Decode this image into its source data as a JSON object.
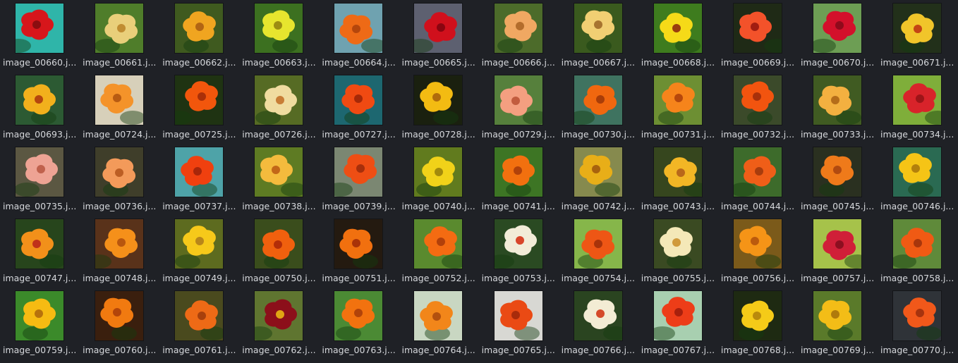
{
  "files": [
    {
      "name": "image_00660.j...",
      "bg": "#2fb5a9",
      "petal": "#d7161b",
      "center": "#8a0d10",
      "icon": "flower-photo"
    },
    {
      "name": "image_00661.j...",
      "bg": "#4f7d2a",
      "petal": "#e9cf7a",
      "center": "#c08d32",
      "icon": "flower-photo"
    },
    {
      "name": "image_00662.j...",
      "bg": "#3f5a1f",
      "petal": "#f0a520",
      "center": "#b26513",
      "icon": "flower-photo"
    },
    {
      "name": "image_00663.j...",
      "bg": "#3c7020",
      "petal": "#e7e52e",
      "center": "#9d8d12",
      "icon": "flower-photo"
    },
    {
      "name": "image_00664.j...",
      "bg": "#6fa2b0",
      "petal": "#ee6a16",
      "center": "#b5460c",
      "icon": "flower-photo"
    },
    {
      "name": "image_00665.j...",
      "bg": "#5d6070",
      "petal": "#d0101c",
      "center": "#8a0510",
      "icon": "flower-photo"
    },
    {
      "name": "image_00666.j...",
      "bg": "#4c6b2a",
      "petal": "#f0a862",
      "center": "#b36d2c",
      "icon": "flower-photo"
    },
    {
      "name": "image_00667.j...",
      "bg": "#3a5a1e",
      "petal": "#f1cf73",
      "center": "#a77430",
      "icon": "flower-photo"
    },
    {
      "name": "image_00668.j...",
      "bg": "#3e7c1e",
      "petal": "#f5da18",
      "center": "#9a3d0e",
      "icon": "flower-photo"
    },
    {
      "name": "image_00669.j...",
      "bg": "#1f2a16",
      "petal": "#f3522a",
      "center": "#a11d11",
      "icon": "flower-photo"
    },
    {
      "name": "image_00670.j...",
      "bg": "#6d9e54",
      "petal": "#d3102b",
      "center": "#8f0a1b",
      "icon": "flower-photo"
    },
    {
      "name": "image_00671.j...",
      "bg": "#22301a",
      "petal": "#f1c52a",
      "center": "#c44414",
      "icon": "flower-photo"
    },
    {
      "name": "image_00693.j...",
      "bg": "#2c5a33",
      "petal": "#f2b01c",
      "center": "#b5460e",
      "icon": "flower-photo"
    },
    {
      "name": "image_00724.j...",
      "bg": "#d7d0ba",
      "petal": "#f4932a",
      "center": "#b85b12",
      "icon": "flower-photo"
    },
    {
      "name": "image_00725.j...",
      "bg": "#1f3312",
      "petal": "#f2560c",
      "center": "#a92f08",
      "icon": "flower-photo"
    },
    {
      "name": "image_00726.j...",
      "bg": "#566b24",
      "petal": "#f0dca0",
      "center": "#c87d36",
      "icon": "flower-photo"
    },
    {
      "name": "image_00727.j...",
      "bg": "#1d6770",
      "petal": "#f04a12",
      "center": "#a52908",
      "icon": "flower-photo"
    },
    {
      "name": "image_00728.j...",
      "bg": "#1a200f",
      "petal": "#f3bb12",
      "center": "#b06b0b",
      "icon": "flower-photo"
    },
    {
      "name": "image_00729.j...",
      "bg": "#56803c",
      "petal": "#f49f80",
      "center": "#c25c3e",
      "icon": "flower-photo"
    },
    {
      "name": "image_00730.j...",
      "bg": "#3f7360",
      "petal": "#f0670f",
      "center": "#a93d08",
      "icon": "flower-photo"
    },
    {
      "name": "image_00731.j...",
      "bg": "#6d8f33",
      "petal": "#f6841b",
      "center": "#b6470c",
      "icon": "flower-photo"
    },
    {
      "name": "image_00732.j...",
      "bg": "#3b4a2a",
      "petal": "#f2540f",
      "center": "#a8300a",
      "icon": "flower-photo"
    },
    {
      "name": "image_00733.j...",
      "bg": "#405b22",
      "petal": "#f3b040",
      "center": "#b56d1a",
      "icon": "flower-photo"
    },
    {
      "name": "image_00734.j...",
      "bg": "#7fae3a",
      "petal": "#d8232a",
      "center": "#9d1418",
      "icon": "flower-photo"
    },
    {
      "name": "image_00735.j...",
      "bg": "#5b5742",
      "petal": "#eea394",
      "center": "#c0614d",
      "icon": "flower-photo"
    },
    {
      "name": "image_00736.j...",
      "bg": "#3f3e2a",
      "petal": "#f39a5a",
      "center": "#bc5e24",
      "icon": "flower-photo"
    },
    {
      "name": "image_00737.j...",
      "bg": "#4ea3a8",
      "petal": "#f0400f",
      "center": "#a8260a",
      "icon": "flower-photo"
    },
    {
      "name": "image_00738.j...",
      "bg": "#5e7b23",
      "petal": "#f4bb3d",
      "center": "#c26718",
      "icon": "flower-photo"
    },
    {
      "name": "image_00739.j...",
      "bg": "#7b8772",
      "petal": "#ee4e14",
      "center": "#a72f0b",
      "icon": "flower-photo"
    },
    {
      "name": "image_00740.j...",
      "bg": "#617b1e",
      "petal": "#f1d219",
      "center": "#a38a0c",
      "icon": "flower-photo"
    },
    {
      "name": "image_00741.j...",
      "bg": "#3d7524",
      "petal": "#f2700f",
      "center": "#b1410a",
      "icon": "flower-photo"
    },
    {
      "name": "image_00742.j...",
      "bg": "#868a4e",
      "petal": "#e8ae18",
      "center": "#a8620e",
      "icon": "flower-photo"
    },
    {
      "name": "image_00743.j...",
      "bg": "#36461e",
      "petal": "#f2b625",
      "center": "#b9681a",
      "icon": "flower-photo"
    },
    {
      "name": "image_00744.j...",
      "bg": "#3d6b2b",
      "petal": "#ef5e18",
      "center": "#a83c0d",
      "icon": "flower-photo"
    },
    {
      "name": "image_00745.j...",
      "bg": "#2a3020",
      "petal": "#ef7a1a",
      "center": "#b14a10",
      "icon": "flower-photo"
    },
    {
      "name": "image_00746.j...",
      "bg": "#2a6a52",
      "petal": "#f5c416",
      "center": "#b3800c",
      "icon": "flower-photo"
    },
    {
      "name": "image_00747.j...",
      "bg": "#27451c",
      "petal": "#f2901a",
      "center": "#c0311a",
      "icon": "flower-photo"
    },
    {
      "name": "image_00748.j...",
      "bg": "#59321a",
      "petal": "#f5901a",
      "center": "#b8560e",
      "icon": "flower-photo"
    },
    {
      "name": "image_00749.j...",
      "bg": "#5d6b1f",
      "petal": "#f6c91a",
      "center": "#b8861a",
      "icon": "flower-photo"
    },
    {
      "name": "image_00750.j...",
      "bg": "#3a4d1c",
      "petal": "#f0600e",
      "center": "#b32d08",
      "icon": "flower-photo"
    },
    {
      "name": "image_00751.j...",
      "bg": "#241a10",
      "petal": "#f1700f",
      "center": "#a93308",
      "icon": "flower-photo"
    },
    {
      "name": "image_00752.j...",
      "bg": "#5a8a2e",
      "petal": "#f46b12",
      "center": "#b2400a",
      "icon": "flower-photo"
    },
    {
      "name": "image_00753.j...",
      "bg": "#2a4a22",
      "petal": "#f2ecd8",
      "center": "#d8452a",
      "icon": "flower-photo"
    },
    {
      "name": "image_00754.j...",
      "bg": "#86b64a",
      "petal": "#ee5615",
      "center": "#a8330a",
      "icon": "flower-photo"
    },
    {
      "name": "image_00755.j...",
      "bg": "#3a4a22",
      "petal": "#f4e8b8",
      "center": "#d09a3c",
      "icon": "flower-photo"
    },
    {
      "name": "image_00756.j...",
      "bg": "#7b5a1a",
      "petal": "#f59417",
      "center": "#bb5a0d",
      "icon": "flower-photo"
    },
    {
      "name": "image_00757.j...",
      "bg": "#a6c24a",
      "petal": "#d01f38",
      "center": "#8c0f20",
      "icon": "flower-photo"
    },
    {
      "name": "image_00758.j...",
      "bg": "#5f8a3a",
      "petal": "#f05a14",
      "center": "#a8360c",
      "icon": "flower-photo"
    },
    {
      "name": "image_00759.j...",
      "bg": "#3b8a2a",
      "petal": "#f6bb12",
      "center": "#b7720c",
      "icon": "flower-photo"
    },
    {
      "name": "image_00760.j...",
      "bg": "#3a1f0e",
      "petal": "#f17a10",
      "center": "#b3450a",
      "icon": "flower-photo"
    },
    {
      "name": "image_00761.j...",
      "bg": "#4a4a1e",
      "petal": "#ee6a16",
      "center": "#a8400c",
      "icon": "flower-photo"
    },
    {
      "name": "image_00762.j...",
      "bg": "#5f7530",
      "petal": "#8c0f1a",
      "center": "#e0a414",
      "icon": "flower-photo"
    },
    {
      "name": "image_00763.j...",
      "bg": "#4b8a34",
      "petal": "#f2720f",
      "center": "#b1430a",
      "icon": "flower-photo"
    },
    {
      "name": "image_00764.j...",
      "bg": "#c9d7c2",
      "petal": "#f2861a",
      "center": "#b3500e",
      "icon": "flower-photo"
    },
    {
      "name": "image_00765.j...",
      "bg": "#d8d8d3",
      "petal": "#ea4a14",
      "center": "#a82b0b",
      "icon": "flower-photo"
    },
    {
      "name": "image_00766.j...",
      "bg": "#2a4420",
      "petal": "#f3ecd4",
      "center": "#d54a2a",
      "icon": "flower-photo"
    },
    {
      "name": "image_00767.j...",
      "bg": "#a8cfb0",
      "petal": "#ed3d18",
      "center": "#a8200d",
      "icon": "flower-photo"
    },
    {
      "name": "image_00768.j...",
      "bg": "#1e2a12",
      "petal": "#f5cb18",
      "center": "#b98a0c",
      "icon": "flower-photo"
    },
    {
      "name": "image_00769.j...",
      "bg": "#5a7a2a",
      "petal": "#f3bd17",
      "center": "#b07a0c",
      "icon": "flower-photo"
    },
    {
      "name": "image_00770.j...",
      "bg": "#2f3338",
      "petal": "#f1581a",
      "center": "#a6330e",
      "icon": "flower-photo"
    }
  ]
}
